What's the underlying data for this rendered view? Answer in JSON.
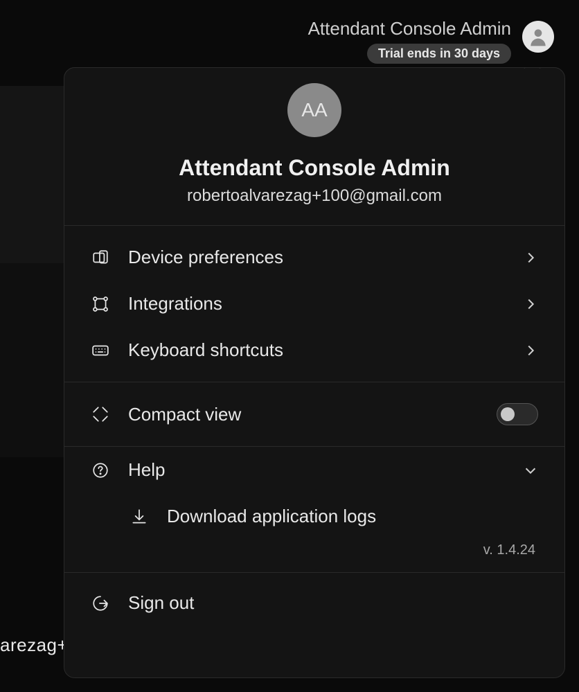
{
  "header": {
    "name": "Attendant Console Admin",
    "trial_badge": "Trial ends in 30 days"
  },
  "profile": {
    "initials": "AA",
    "name": "Attendant Console Admin",
    "email": "robertoalvarezag+100@gmail.com"
  },
  "menu": {
    "device_prefs": "Device preferences",
    "integrations": "Integrations",
    "keyboard_shortcuts": "Keyboard shortcuts",
    "compact_view": "Compact view",
    "help": "Help",
    "download_logs": "Download application logs",
    "sign_out": "Sign out"
  },
  "version": "v. 1.4.24",
  "bg_text_fragment": "arezag+"
}
